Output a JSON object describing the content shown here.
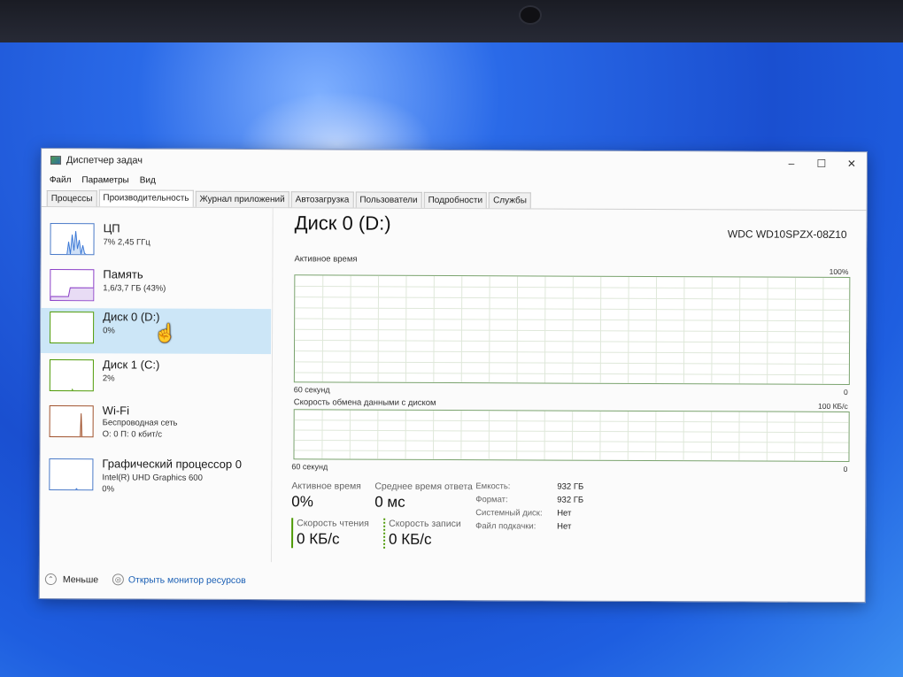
{
  "window": {
    "title": "Диспетчер задач"
  },
  "menu": [
    "Файл",
    "Параметры",
    "Вид"
  ],
  "tabs": [
    {
      "label": "Процессы",
      "active": false
    },
    {
      "label": "Производительность",
      "active": true
    },
    {
      "label": "Журнал приложений",
      "active": false
    },
    {
      "label": "Автозагрузка",
      "active": false
    },
    {
      "label": "Пользователи",
      "active": false
    },
    {
      "label": "Подробности",
      "active": false
    },
    {
      "label": "Службы",
      "active": false
    }
  ],
  "sidebar": [
    {
      "title": "ЦП",
      "line1": "7% 2,45 ГГц",
      "line2": "",
      "color": "#3b78d6",
      "selected": false
    },
    {
      "title": "Память",
      "line1": "1,6/3,7 ГБ (43%)",
      "line2": "",
      "color": "#8b3fc7",
      "selected": false
    },
    {
      "title": "Диск 0 (D:)",
      "line1": "0%",
      "line2": "",
      "color": "#4e9a06",
      "selected": true
    },
    {
      "title": "Диск 1 (C:)",
      "line1": "2%",
      "line2": "",
      "color": "#4e9a06",
      "selected": false
    },
    {
      "title": "Wi-Fi",
      "line1": "Беспроводная сеть",
      "line2": "О: 0 П: 0 кбит/с",
      "color": "#a0522d",
      "selected": false
    },
    {
      "title": "Графический процессор 0",
      "line1": "Intel(R) UHD Graphics 600",
      "line2": "0%",
      "color": "#3b78d6",
      "selected": false
    }
  ],
  "main": {
    "title": "Диск 0 (D:)",
    "model": "WDC WD10SPZX-08Z10",
    "graph1": {
      "label": "Активное время",
      "max": "100%",
      "time": "60 секунд",
      "min": "0"
    },
    "graph2": {
      "label": "Скорость обмена данными с диском",
      "max": "100 КБ/с",
      "time": "60 секунд",
      "min": "0"
    },
    "stats": {
      "active_time_label": "Активное время",
      "active_time_value": "0%",
      "avg_response_label": "Среднее время ответа",
      "avg_response_value": "0 мс",
      "read_label": "Скорость чтения",
      "read_value": "0 КБ/с",
      "write_label": "Скорость записи",
      "write_value": "0 КБ/с"
    },
    "properties": [
      {
        "label": "Емкость:",
        "value": "932 ГБ"
      },
      {
        "label": "Формат:",
        "value": "932 ГБ"
      },
      {
        "label": "Системный диск:",
        "value": "Нет"
      },
      {
        "label": "Файл подкачки:",
        "value": "Нет"
      }
    ]
  },
  "footer": {
    "less_label": "Меньше",
    "resource_monitor_label": "Открыть монитор ресурсов"
  },
  "icons": {
    "chevron": "chevron-up-icon",
    "monitor": "resource-monitor-icon"
  },
  "accent": "#4e9a06"
}
